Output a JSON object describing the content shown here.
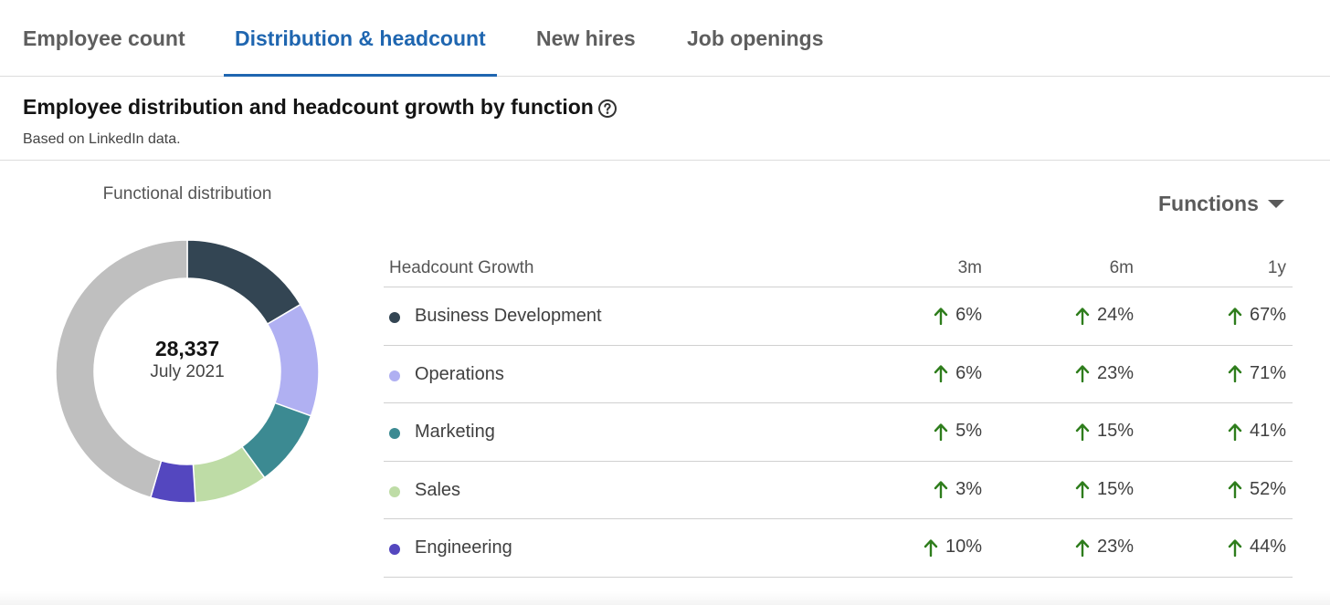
{
  "tabs": [
    {
      "label": "Employee count",
      "active": false
    },
    {
      "label": "Distribution & headcount",
      "active": true
    },
    {
      "label": "New hires",
      "active": false
    },
    {
      "label": "Job openings",
      "active": false
    }
  ],
  "section": {
    "title": "Employee distribution and headcount growth by function",
    "subtitle": "Based on LinkedIn data.",
    "help_icon": "question-circle-icon"
  },
  "chart_data": {
    "type": "pie",
    "title": "Functional distribution",
    "center_value": "28,337",
    "center_label": "July 2021",
    "colors": {
      "Business Development": "#334553",
      "Operations": "#b0b0f2",
      "Marketing": "#3c8a92",
      "Sales": "#bedca6",
      "Engineering": "#5447bf",
      "Other": "#bfbfbf"
    },
    "slices": [
      {
        "label": "Business Development",
        "fraction": 0.165
      },
      {
        "label": "Operations",
        "fraction": 0.14
      },
      {
        "label": "Marketing",
        "fraction": 0.095
      },
      {
        "label": "Sales",
        "fraction": 0.09
      },
      {
        "label": "Engineering",
        "fraction": 0.055
      },
      {
        "label": "Other",
        "fraction": 0.455
      }
    ]
  },
  "functions_dropdown": {
    "label": "Functions",
    "icon": "caret-down-icon"
  },
  "growth_table": {
    "headers": [
      "Headcount Growth",
      "3m",
      "6m",
      "1y"
    ],
    "trend_icon": "arrow-up-icon",
    "trend_color": "#2e7d1c",
    "rows": [
      {
        "name": "Business Development",
        "color": "#334553",
        "m3": "6%",
        "m6": "24%",
        "y1": "67%"
      },
      {
        "name": "Operations",
        "color": "#b0b0f2",
        "m3": "6%",
        "m6": "23%",
        "y1": "71%"
      },
      {
        "name": "Marketing",
        "color": "#3c8a92",
        "m3": "5%",
        "m6": "15%",
        "y1": "41%"
      },
      {
        "name": "Sales",
        "color": "#bedca6",
        "m3": "3%",
        "m6": "15%",
        "y1": "52%"
      },
      {
        "name": "Engineering",
        "color": "#5447bf",
        "m3": "10%",
        "m6": "23%",
        "y1": "44%"
      }
    ]
  }
}
